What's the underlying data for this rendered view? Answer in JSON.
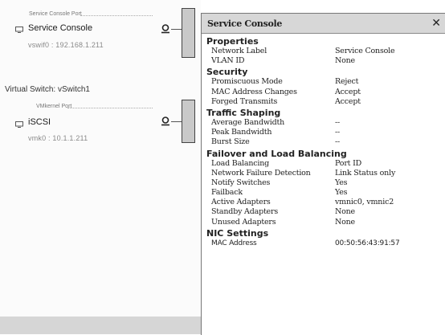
{
  "diagram": {
    "port_groups": [
      {
        "type_label": "Service Console Port",
        "name": "Service Console",
        "sub": "vswif0 : 192.168.1.211"
      },
      {
        "type_label": "VMkernel Port",
        "name": "iSCSI",
        "sub": "vmk0 : 10.1.1.211"
      }
    ],
    "vswitch_title": "Virtual Switch: vSwitch1"
  },
  "panel": {
    "title": "Service Console",
    "close_label": "✕",
    "sections": [
      {
        "heading": "Properties",
        "rows": [
          {
            "key": "Network Label",
            "value": "Service Console"
          },
          {
            "key": "VLAN ID",
            "value": "None"
          }
        ]
      },
      {
        "heading": "Security",
        "rows": [
          {
            "key": "Promiscuous Mode",
            "value": "Reject"
          },
          {
            "key": "MAC Address Changes",
            "value": "Accept"
          },
          {
            "key": "Forged Transmits",
            "value": "Accept"
          }
        ]
      },
      {
        "heading": "Traffic Shaping",
        "rows": [
          {
            "key": "Average Bandwidth",
            "value": "--"
          },
          {
            "key": "Peak Bandwidth",
            "value": "--"
          },
          {
            "key": "Burst Size",
            "value": "--"
          }
        ]
      },
      {
        "heading": "Failover and Load Balancing",
        "rows": [
          {
            "key": "Load Balancing",
            "value": "Port ID"
          },
          {
            "key": "Network Failure Detection",
            "value": "Link Status only"
          },
          {
            "key": "Notify Switches",
            "value": "Yes"
          },
          {
            "key": "Failback",
            "value": "Yes"
          },
          {
            "key": "Active Adapters",
            "value": "vmnic0, vmnic2"
          },
          {
            "key": "Standby Adapters",
            "value": "None"
          },
          {
            "key": "Unused Adapters",
            "value": "None"
          }
        ]
      },
      {
        "heading": "NIC Settings",
        "rows": [
          {
            "key": "MAC Address",
            "value": "00:50:56:43:91:57"
          }
        ]
      }
    ]
  },
  "icons": {
    "monitor": "monitor-icon",
    "connection": "network-connection-icon",
    "close": "close-icon"
  }
}
